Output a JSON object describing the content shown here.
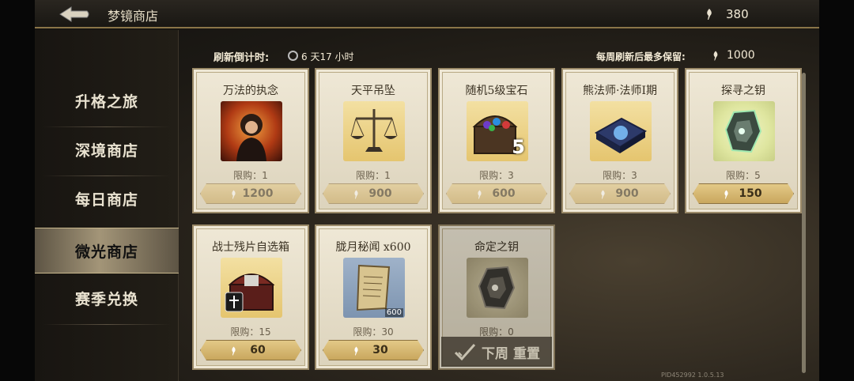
{
  "header": {
    "title": "梦镜商店",
    "currency_value": "380"
  },
  "sidebar": {
    "items": [
      {
        "label": "升格之旅"
      },
      {
        "label": "深境商店"
      },
      {
        "label": "每日商店"
      },
      {
        "label": "微光商店",
        "active": true
      },
      {
        "label": "赛季兑换"
      }
    ]
  },
  "info": {
    "refresh_label": "刷新倒计时:",
    "refresh_value": "6 天17 小时",
    "keep_label": "每周刷新后最多保留:",
    "keep_value": "1000"
  },
  "items": [
    {
      "name": "万法的执念",
      "limit": "限购：1",
      "price": "1200",
      "icon": "portrait-icon",
      "affordable": false
    },
    {
      "name": "天平吊坠",
      "limit": "限购：1",
      "price": "900",
      "icon": "scale-pendant-icon",
      "affordable": false
    },
    {
      "name": "随机5级宝石",
      "limit": "限购：3",
      "price": "600",
      "icon": "gem-chest-icon",
      "badge": "5",
      "affordable": false
    },
    {
      "name": "熊法师·法师Ⅰ期",
      "limit": "限购：3",
      "price": "900",
      "icon": "spellbook-icon",
      "affordable": false
    },
    {
      "name": "探寻之钥",
      "limit": "限购：5",
      "price": "150",
      "icon": "green-crystal-icon",
      "affordable": true
    },
    {
      "name": "战士残片自选箱",
      "limit": "限购：15",
      "price": "60",
      "icon": "warrior-chest-icon",
      "affordable": true
    },
    {
      "name": "胧月秘闻 x600",
      "limit": "限购：30",
      "price": "30",
      "icon": "scroll-icon",
      "badge": "600",
      "affordable": true
    },
    {
      "name": "命定之钥",
      "limit": "限购：0",
      "icon": "dark-crystal-icon",
      "sold_out_label": "下周 重置"
    }
  ],
  "footer": {
    "version": "PID452992  1.0.5.13"
  },
  "colors": {
    "accent_gold": "#c9a75e",
    "card_bg": "#efe8d6"
  }
}
